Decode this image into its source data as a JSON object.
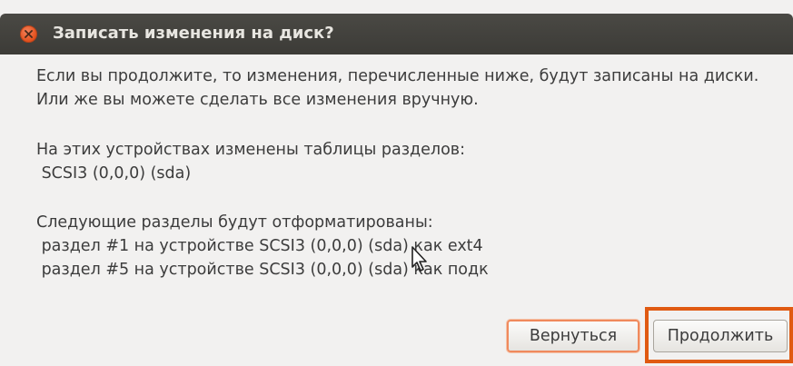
{
  "window": {
    "title": "Записать изменения на диск?"
  },
  "message": {
    "intro_line1": "Если вы продолжите, то изменения, перечисленные ниже, будут записаны на диски.",
    "intro_line2": "Или же вы можете сделать все изменения вручную.",
    "tables_heading": "На этих устройствах изменены таблицы разделов:",
    "tables_device": " SCSI3 (0,0,0) (sda)",
    "format_heading": "Следующие разделы будут отформатированы:",
    "format_items": [
      " раздел #1 на устройстве SCSI3 (0,0,0) (sda) как ext4",
      " раздел #5 на устройстве SCSI3 (0,0,0) (sda) как подк"
    ]
  },
  "buttons": {
    "back_label": "Вернуться",
    "continue_label": "Продолжить"
  },
  "colors": {
    "titlebar": "#3c3b37",
    "close_button": "#e2501c",
    "highlight": "#e05a12",
    "focus_ring": "#f08a5d"
  }
}
